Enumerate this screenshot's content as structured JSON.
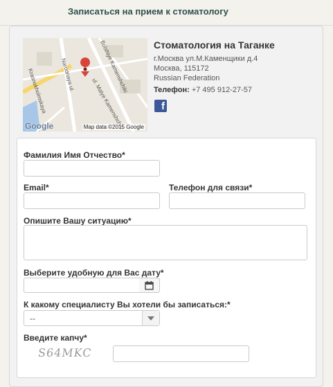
{
  "page": {
    "title": "Записаться на прием к стоматологу"
  },
  "map": {
    "attribution": "Map data ©2015 Google",
    "logo": "Google",
    "streets": [
      "Narodnaya ul.",
      "Bolshiye Kamenshchiki",
      "ul. Malye Kamenshchiki",
      "Krasnokholmskaya"
    ]
  },
  "clinic": {
    "name": "Стоматология на Таганке",
    "address_line1": "г.Москва ул.М.Каменщики д.4",
    "address_line2": "Москва, 115172",
    "address_line3": "Russian Federation",
    "phone_label": "Телефон:",
    "phone_value": " +7 495 912-27-57",
    "facebook_glyph": "f"
  },
  "form": {
    "fio_label": "Фамилия Имя Отчество",
    "email_label": "Email",
    "phone_label": "Телефон для связи",
    "situation_label": "Опишите Вашу ситуацию",
    "date_label": "Выберите удобную для Вас дату",
    "specialist_label": "К какому специалисту Вы хотели бы записаться:",
    "specialist_selected": "--",
    "captcha_label": "Введите капчу",
    "captcha_text": "S64MKC",
    "required_mark": "*"
  }
}
